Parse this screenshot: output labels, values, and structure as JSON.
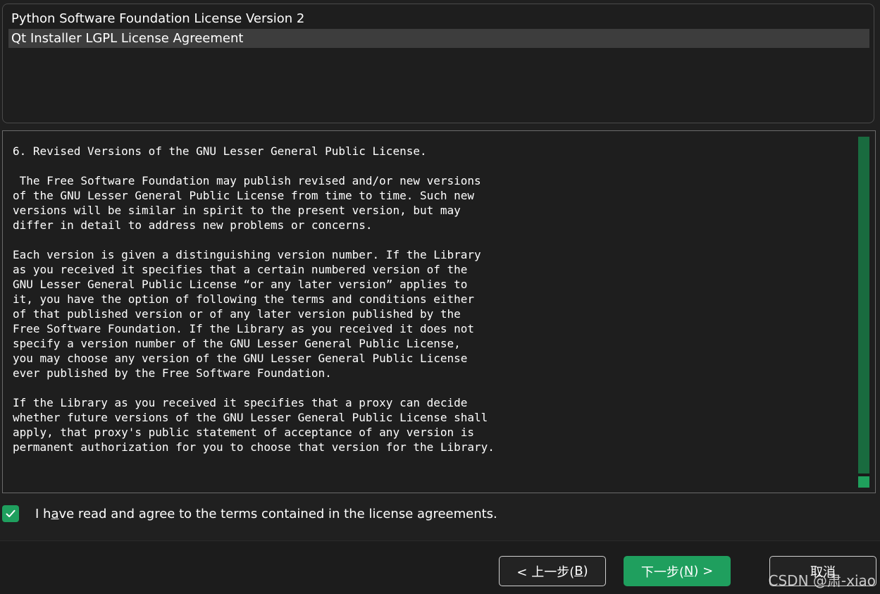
{
  "license_list": {
    "items": [
      {
        "label": "Python Software Foundation License Version 2",
        "selected": false
      },
      {
        "label": "Qt Installer LGPL License Agreement",
        "selected": true
      }
    ]
  },
  "license_text": {
    "content": "6. Revised Versions of the GNU Lesser General Public License.\n\n The Free Software Foundation may publish revised and/or new versions\nof the GNU Lesser General Public License from time to time. Such new\nversions will be similar in spirit to the present version, but may\ndiffer in detail to address new problems or concerns.\n\nEach version is given a distinguishing version number. If the Library\nas you received it specifies that a certain numbered version of the\nGNU Lesser General Public License “or any later version” applies to\nit, you have the option of following the terms and conditions either\nof that published version or of any later version published by the\nFree Software Foundation. If the Library as you received it does not\nspecify a version number of the GNU Lesser General Public License,\nyou may choose any version of the GNU Lesser General Public License\never published by the Free Software Foundation.\n\nIf the Library as you received it specifies that a proxy can decide\nwhether future versions of the GNU Lesser General Public License shall\napply, that proxy's public statement of acceptance of any version is\npermanent authorization for you to choose that version for the Library."
  },
  "agreement": {
    "checked": true,
    "label_prefix": "I h",
    "label_mnemonic": "a",
    "label_suffix": "ve read and agree to the terms contained in the license agreements."
  },
  "buttons": {
    "back_prefix": "< 上一步(",
    "back_mnemonic": "B",
    "back_suffix": ")",
    "next_prefix": "下一步(",
    "next_mnemonic": "N",
    "next_suffix": ") >",
    "cancel_label": "取消"
  },
  "watermark": "CSDN @肃-xiao",
  "colors": {
    "accent": "#1f9f5e",
    "scrollbar": "#196b3f",
    "background": "#202020",
    "selection": "#3d3d3d"
  }
}
